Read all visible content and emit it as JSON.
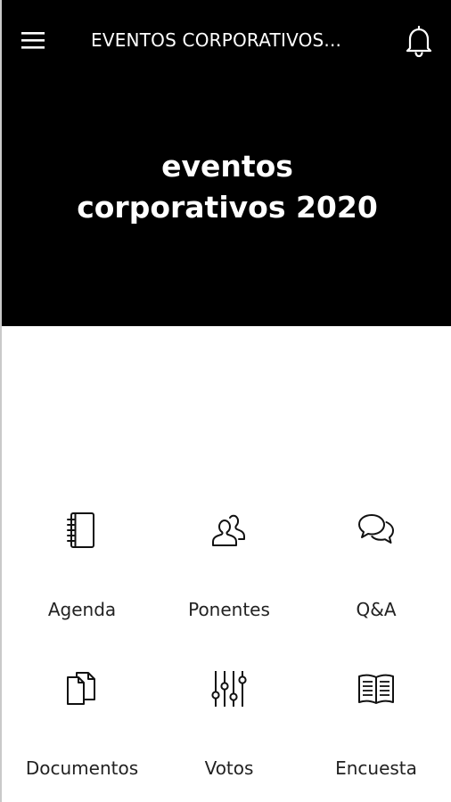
{
  "topbar": {
    "menu_icon": "hamburger-menu-icon",
    "title": "EVENTOS CORPORATIVOS...",
    "notification_icon": "bell-icon"
  },
  "hero": {
    "line1": "eventos",
    "line2": "corporativos 2020"
  },
  "colors": {
    "header_bg": "#000000",
    "header_text": "#ffffff",
    "body_bg": "#ffffff",
    "icon_stroke": "#111111"
  },
  "menu": [
    {
      "label": "Agenda",
      "icon": "agenda-notebook-icon"
    },
    {
      "label": "Ponentes",
      "icon": "speakers-people-icon"
    },
    {
      "label": "Q&A",
      "icon": "chat-bubbles-icon"
    },
    {
      "label": "Documentos",
      "icon": "documents-icon"
    },
    {
      "label": "Votos",
      "icon": "sliders-icon"
    },
    {
      "label": "Encuesta",
      "icon": "open-book-icon"
    }
  ]
}
